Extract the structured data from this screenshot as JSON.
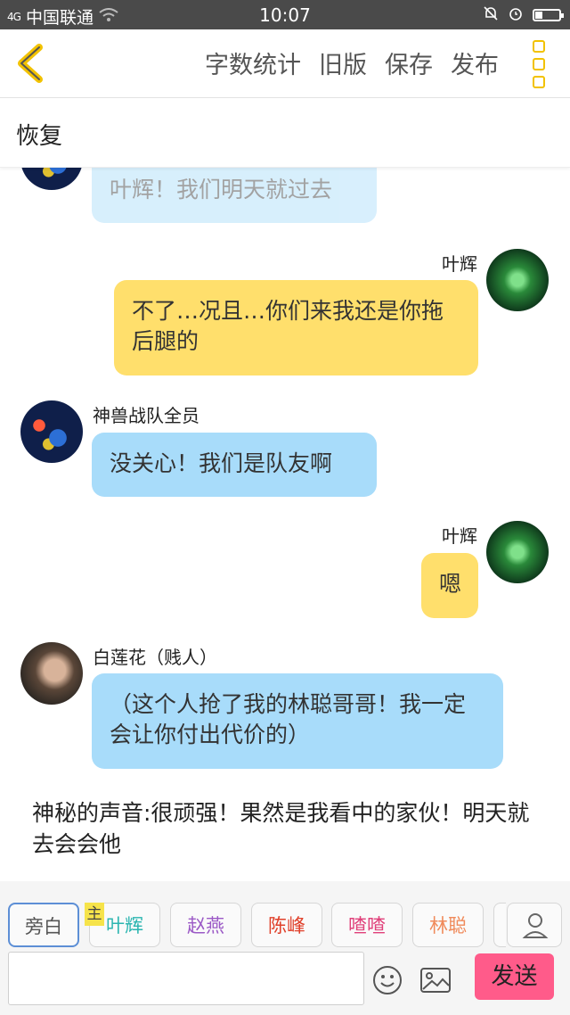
{
  "status_bar": {
    "signal": "4G",
    "carrier": "中国联通",
    "time": "10:07"
  },
  "toolbar": {
    "actions": [
      "字数统计",
      "旧版",
      "保存",
      "发布"
    ]
  },
  "restore": {
    "label": "恢复"
  },
  "chat": {
    "messages": [
      {
        "side": "left",
        "speaker": "",
        "text": "叶辉！我们明天就过去",
        "faded": true
      },
      {
        "side": "right",
        "speaker": "叶辉",
        "text": "不了…况且…你们来我还是你拖后腿的"
      },
      {
        "side": "left",
        "speaker": "神兽战队全员",
        "text": "没关心！我们是队友啊"
      },
      {
        "side": "right",
        "speaker": "叶辉",
        "text": "嗯"
      },
      {
        "side": "left",
        "speaker": "白莲花（贱人）",
        "text": "（这个人抢了我的林聪哥哥！我一定会让你付出代价的）"
      }
    ],
    "narration": "神秘的声音:很顽强！果然是我看中的家伙！明天就去会会他"
  },
  "role_bar": {
    "main_tag": "主",
    "roles": [
      {
        "label": "旁白",
        "color": "#555555"
      },
      {
        "label": "叶辉",
        "color": "#2bb5b0"
      },
      {
        "label": "赵燕",
        "color": "#9b59c6"
      },
      {
        "label": "陈峰",
        "color": "#e0402a"
      },
      {
        "label": "喳喳",
        "color": "#e0407a"
      },
      {
        "label": "林聪",
        "color": "#f08a5a"
      }
    ],
    "send_label": "发送"
  }
}
